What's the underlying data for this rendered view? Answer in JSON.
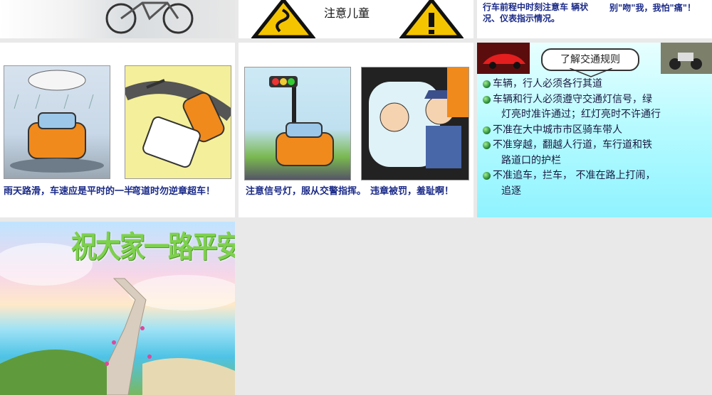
{
  "slides": {
    "top_middle": {
      "sign_label": "注意儿童"
    },
    "top_right": {
      "text_left": "行车前程中时刻注意车 辆状况、仪表指示情况。",
      "text_right": "别\"吻\"我，我怕\"痛\"！"
    },
    "mid_left": {
      "caption_left": "雨天路滑，车速应是平时的一半",
      "caption_right": "弯道时勿逆章超车！"
    },
    "mid_middle": {
      "caption_left": "注意信号灯，服从交警指挥。",
      "caption_right": "违章被罚，羞耻啊！"
    },
    "rules": {
      "title": "了解交通规则",
      "items": [
        {
          "line1": "车辆，行人必须各行其道",
          "line2": ""
        },
        {
          "line1": "车辆和行人必须遵守交通灯信号，绿",
          "line2": "灯亮时准许通过；红灯亮时不许通行"
        },
        {
          "line1": "不准在大中城市市区骑车带人",
          "line2": ""
        },
        {
          "line1": "不准穿越，翻越人行道，车行道和铁",
          "line2": "路道口的护栏"
        },
        {
          "line1": "不准追车，拦车， 不准在路上打闹，",
          "line2": "追逐"
        }
      ]
    },
    "blessing": {
      "text": "祝大家一路平安！"
    }
  },
  "colors": {
    "background": "#e9e9e9",
    "caption": "#1a2a88",
    "rules_bg": "#b9fbff",
    "blessing": "#7dd14c"
  }
}
